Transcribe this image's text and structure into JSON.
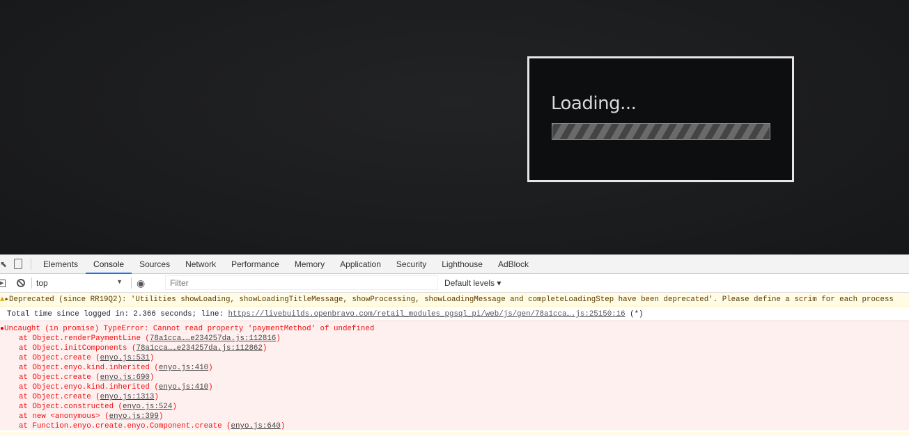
{
  "app": {
    "loading_title": "Loading...",
    "progress_indeterminate": true
  },
  "devtools": {
    "tabs": [
      "Elements",
      "Console",
      "Sources",
      "Network",
      "Performance",
      "Memory",
      "Application",
      "Security",
      "Lighthouse",
      "AdBlock"
    ],
    "active_tab": "Console",
    "context": "top",
    "filter_placeholder": "Filter",
    "levels": "Default levels ▾",
    "messages": {
      "warning": "▸Deprecated (since RR19Q2): 'Utilities showLoading, showLoadingTitleMessage, showProcessing, showLoadingMessage and completeLoadingStep have been deprecated'. Please define a scrim for each process",
      "log_text": "Total time since logged in: 2.366 seconds; line: ",
      "log_link": "https://livebuilds.openbravo.com/retail_modules_pgsql_pi/web/js/gen/78a1cca….js:25150:16",
      "log_suffix": " (*)",
      "error": "Uncaught (in promise) TypeError: Cannot read property 'paymentMethod' of undefined",
      "stack": [
        {
          "fn": "at Object.renderPaymentLine ",
          "src": "78a1cca……e234257da.js:112816"
        },
        {
          "fn": "at Object.initComponents ",
          "src": "78a1cca……e234257da.js:112862"
        },
        {
          "fn": "at Object.create ",
          "src": "enyo.js:531"
        },
        {
          "fn": "at Object.enyo.kind.inherited ",
          "src": "enyo.js:410"
        },
        {
          "fn": "at Object.create ",
          "src": "enyo.js:690"
        },
        {
          "fn": "at Object.enyo.kind.inherited ",
          "src": "enyo.js:410"
        },
        {
          "fn": "at Object.create ",
          "src": "enyo.js:1313"
        },
        {
          "fn": "at Object.constructed ",
          "src": "enyo.js:524"
        },
        {
          "fn": "at new <anonymous> ",
          "src": "enyo.js:399"
        },
        {
          "fn": "at Function.enyo.create.enyo.Component.create ",
          "src": "enyo.js:640"
        }
      ]
    }
  }
}
